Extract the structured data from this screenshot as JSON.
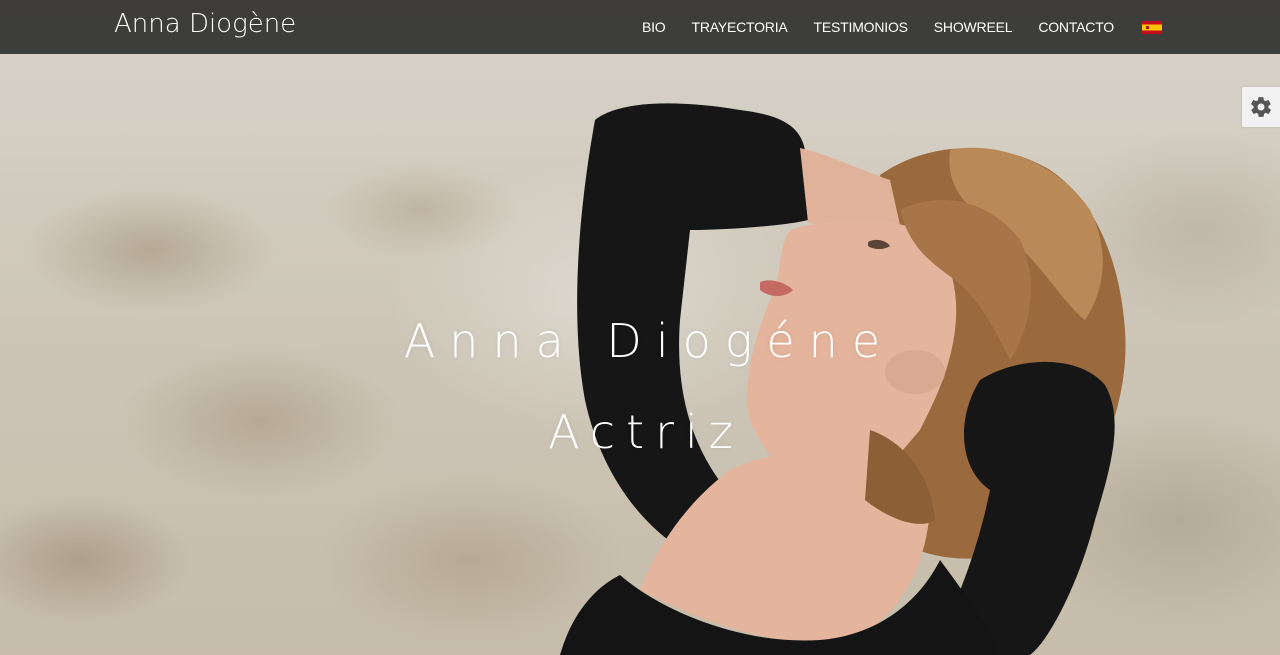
{
  "brand": "Anna Diogène",
  "nav": {
    "items": [
      {
        "label": "BIO"
      },
      {
        "label": "TRAYECTORIA"
      },
      {
        "label": "TESTIMONIOS"
      },
      {
        "label": "SHOWREEL"
      },
      {
        "label": "CONTACTO"
      }
    ],
    "language_flag": "spain-flag-icon"
  },
  "hero": {
    "name": "Anna Diogéne",
    "role": "Actriz"
  },
  "settings": {
    "icon": "gear-icon"
  },
  "colors": {
    "navbar_bg": "#282828",
    "text": "#ffffff",
    "settings_bg": "#f1f1f1",
    "settings_icon": "#555555"
  }
}
